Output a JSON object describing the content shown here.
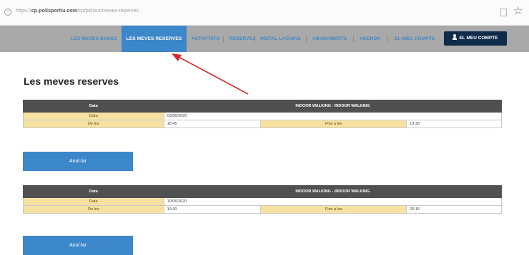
{
  "browser": {
    "info_icon": "i",
    "url_prefix": "https://",
    "url_domain": "cp.polisportiu.com",
    "url_path": "/cp/polisut/meves-reserves",
    "bookmark_icon": "star-icon",
    "star": "☆"
  },
  "nav": {
    "items": [
      "LES MEVES DADES",
      "ACTIVITATS",
      "RESERVES",
      "INSTAL·LACIONS",
      "ABONAMENTS",
      "AGENDA",
      "EL MEU COMPTE"
    ],
    "active": "LES MEVES RESERVES",
    "account_button": "EL MEU COMPTE"
  },
  "page_title": "Les meves reserves",
  "reservations": [
    {
      "header_left": "Data",
      "header_right": "INDOOR WALKING - INDOOR WALKING",
      "data_label": "Data",
      "data_value": "03/06/2020",
      "start_label": "De les",
      "start_value": "18:45",
      "end_label": "Fins a les",
      "end_value": "19:30"
    },
    {
      "header_left": "Data",
      "header_right": "INDOOR WALKING - INDOOR WALKING",
      "data_label": "Data",
      "data_value": "10/06/2020",
      "start_label": "De les",
      "start_value": "19:30",
      "end_label": "Fins a les",
      "end_value": "20:15"
    }
  ],
  "cancel_label": "Anul·lar",
  "colors": {
    "nav_bg": "#a9a9a9",
    "accent": "#3b87ca",
    "account_btn": "#0f2b4a",
    "table_header": "#505050",
    "label_cell": "#f7e1a1",
    "annotation_arrow": "#d9262b"
  }
}
